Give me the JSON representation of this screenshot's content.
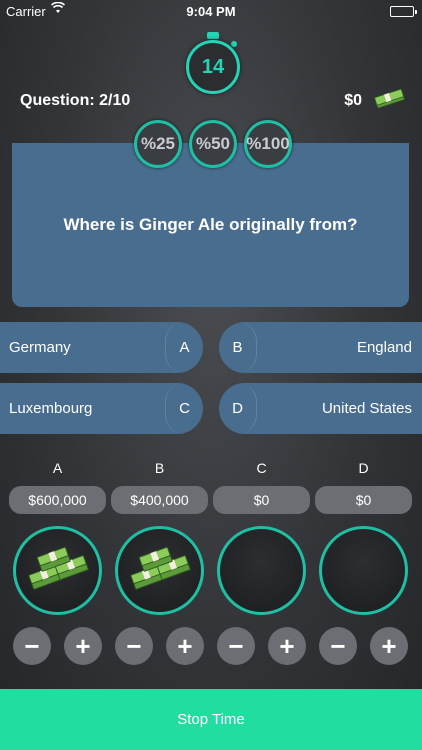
{
  "status_bar": {
    "carrier": "Carrier",
    "time": "9:04 PM"
  },
  "timer": {
    "seconds": "14"
  },
  "header": {
    "question_counter": "Question: 2/10",
    "money": "$0"
  },
  "lifelines": [
    {
      "label": "%25"
    },
    {
      "label": "%50"
    },
    {
      "label": "%100"
    }
  ],
  "question": {
    "text": "Where is Ginger Ale originally from?"
  },
  "answers": [
    {
      "letter": "A",
      "text": "Germany"
    },
    {
      "letter": "B",
      "text": "England"
    },
    {
      "letter": "C",
      "text": "Luxembourg"
    },
    {
      "letter": "D",
      "text": "United States"
    }
  ],
  "bets": [
    {
      "letter": "A",
      "amount": "$600,000",
      "has_money": true,
      "minus": "−",
      "plus": "+"
    },
    {
      "letter": "B",
      "amount": "$400,000",
      "has_money": true,
      "minus": "−",
      "plus": "+"
    },
    {
      "letter": "C",
      "amount": "$0",
      "has_money": false,
      "minus": "−",
      "plus": "+"
    },
    {
      "letter": "D",
      "amount": "$0",
      "has_money": false,
      "minus": "−",
      "plus": "+"
    }
  ],
  "stop_button": {
    "label": "Stop Time"
  },
  "colors": {
    "accent": "#22d5b4",
    "panel": "#496d8f",
    "stop": "#21dda0",
    "pill": "#6b6e72"
  }
}
